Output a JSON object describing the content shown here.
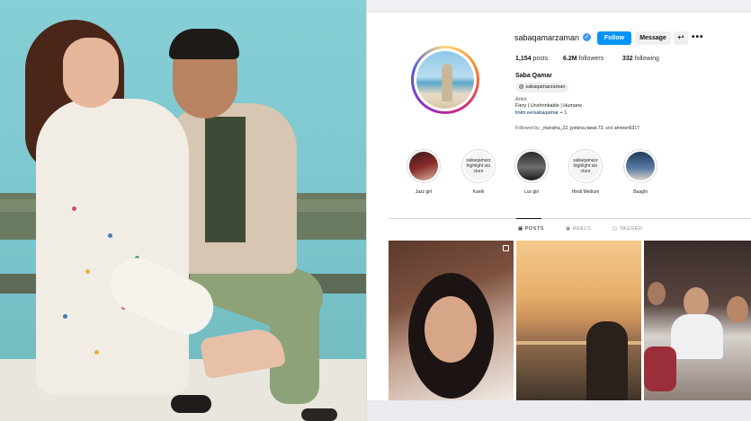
{
  "profile": {
    "username": "sabaqamarzaman",
    "follow_label": "Follow",
    "message_label": "Message",
    "adduser_symbol": "+⁴",
    "more_symbol": "•••",
    "posts_count": "1,154",
    "posts_label": "posts",
    "followers_count": "6.2M",
    "followers_label": "followers",
    "following_count": "332",
    "following_label": "following",
    "name": "Saba Qamar",
    "threads_handle": "sabaqamarzaman",
    "category": "Artist",
    "bio": "Fiery | Unshrinkable | Humane",
    "link": "linktr.ee/sabaqamar + 1",
    "followed_by_prefix": "Followed by",
    "followed_by_names": "_manisha_22, jyotsna.rawat.73,",
    "followed_by_and": "and",
    "followed_by_more": "amreen6317"
  },
  "highlights": [
    {
      "label": "Jazz girl",
      "inner_text": ""
    },
    {
      "label": "Kamli",
      "inner_text": "sabaqamarz highlight sto cture"
    },
    {
      "label": "Lux girl",
      "inner_text": ""
    },
    {
      "label": "Hindi Medium",
      "inner_text": "sabaqamarz highlight sto cture"
    },
    {
      "label": "Baaghi",
      "inner_text": ""
    }
  ],
  "tabs": {
    "posts": "POSTS",
    "reels": "REELS",
    "tagged": "TAGGED"
  },
  "colors": {
    "follow_blue": "#0095f6",
    "verified_blue": "#3897f0",
    "link_blue": "#00376b"
  },
  "icons": {
    "verified": "verified-badge-icon",
    "threads": "threads-icon",
    "posts_tab": "grid-icon",
    "reels_tab": "reels-icon",
    "tagged_tab": "tag-icon",
    "multi": "carousel-icon"
  }
}
